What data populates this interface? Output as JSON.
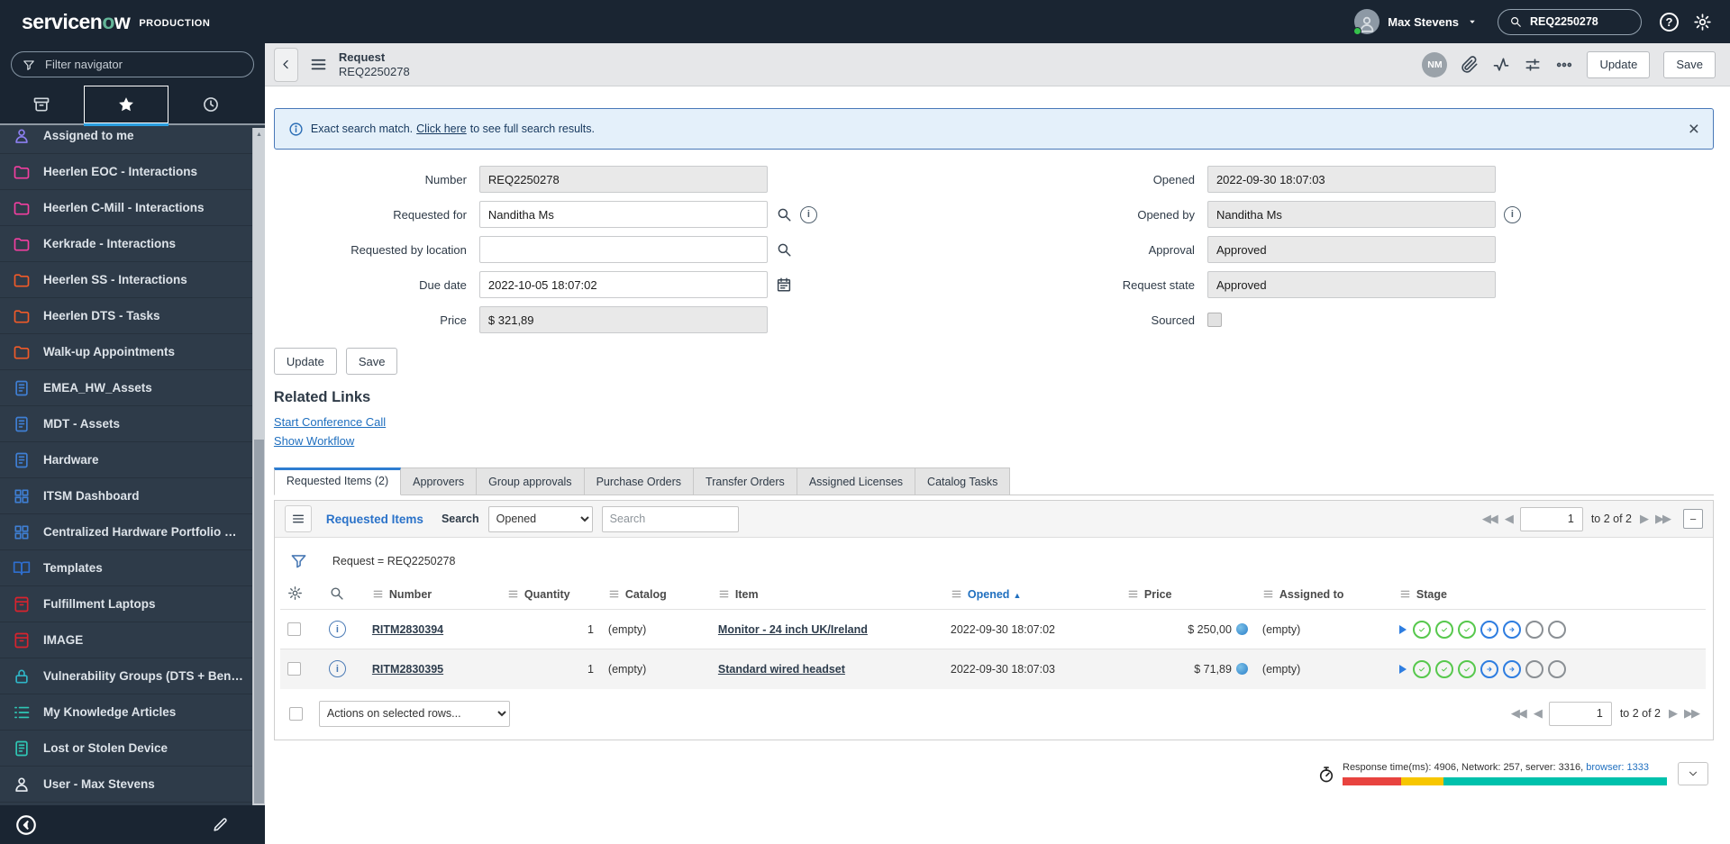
{
  "header": {
    "logo_prefix": "servicen",
    "logo_accent": "o",
    "logo_suffix": "w",
    "env_label": "PRODUCTION",
    "user_name": "Max Stevens",
    "search_value": "REQ2250278"
  },
  "sidebar": {
    "filter_placeholder": "Filter navigator",
    "items": [
      {
        "label": "Assigned to me",
        "icon": "person",
        "color": "#8c7ff0"
      },
      {
        "label": "Heerlen EOC - Interactions",
        "icon": "folder",
        "color": "#f23fa0"
      },
      {
        "label": "Heerlen C-Mill - Interactions",
        "icon": "folder",
        "color": "#f23fa0"
      },
      {
        "label": "Kerkrade - Interactions",
        "icon": "folder",
        "color": "#f23fa0"
      },
      {
        "label": "Heerlen SS - Interactions",
        "icon": "folder",
        "color": "#f05a28"
      },
      {
        "label": "Heerlen DTS - Tasks",
        "icon": "folder",
        "color": "#f05a28"
      },
      {
        "label": "Walk-up Appointments",
        "icon": "folder",
        "color": "#f05a28"
      },
      {
        "label": "EMEA_HW_Assets",
        "icon": "doc",
        "color": "#3f7fd4"
      },
      {
        "label": "MDT - Assets",
        "icon": "doc",
        "color": "#3f7fd4"
      },
      {
        "label": "Hardware",
        "icon": "doc",
        "color": "#3f7fd4"
      },
      {
        "label": "ITSM Dashboard",
        "icon": "grid",
        "color": "#3f7fd4"
      },
      {
        "label": "Centralized Hardware Portfolio …",
        "icon": "grid",
        "color": "#3f7fd4"
      },
      {
        "label": "Templates",
        "icon": "book",
        "color": "#2f6fd0"
      },
      {
        "label": "Fulfillment Laptops",
        "icon": "box",
        "color": "#d9232e"
      },
      {
        "label": "IMAGE",
        "icon": "box",
        "color": "#d9232e"
      },
      {
        "label": "Vulnerability Groups (DTS + Ben…",
        "icon": "lock",
        "color": "#2fb5c7"
      },
      {
        "label": "My Knowledge Articles",
        "icon": "list",
        "color": "#2fc7b5"
      },
      {
        "label": "Lost or Stolen Device",
        "icon": "doc",
        "color": "#2fc7b5"
      },
      {
        "label": "User - Max Stevens",
        "icon": "person",
        "color": "#e8edf2"
      }
    ]
  },
  "form_header": {
    "title": "Request",
    "subtitle": "REQ2250278",
    "avatar_initials": "NM",
    "update_label": "Update",
    "save_label": "Save"
  },
  "banner": {
    "prefix": "Exact search match.",
    "link": "Click here",
    "suffix": "to see full search results.",
    "close": "×"
  },
  "form": {
    "left": [
      {
        "label": "Number",
        "value": "REQ2250278",
        "readonly": true,
        "icons": []
      },
      {
        "label": "Requested for",
        "value": "Nanditha Ms",
        "readonly": false,
        "icons": [
          "magnifier",
          "info"
        ]
      },
      {
        "label": "Requested by location",
        "value": "",
        "readonly": false,
        "icons": [
          "magnifier"
        ]
      },
      {
        "label": "Due date",
        "value": "2022-10-05 18:07:02",
        "readonly": false,
        "icons": [
          "calendar"
        ]
      },
      {
        "label": "Price",
        "value": "$ 321,89",
        "readonly": true,
        "icons": []
      }
    ],
    "right": [
      {
        "label": "Opened",
        "value": "2022-09-30 18:07:03",
        "readonly": true,
        "icons": []
      },
      {
        "label": "Opened by",
        "value": "Nanditha Ms",
        "readonly": true,
        "icons": [
          "info"
        ]
      },
      {
        "label": "Approval",
        "value": "Approved",
        "readonly": true,
        "icons": []
      },
      {
        "label": "Request state",
        "value": "Approved",
        "readonly": true,
        "icons": []
      },
      {
        "label": "Sourced",
        "type": "checkbox",
        "checked": false
      }
    ],
    "buttons": {
      "update": "Update",
      "save": "Save"
    }
  },
  "related_links": {
    "title": "Related Links",
    "links": [
      "Start Conference Call",
      "Show Workflow"
    ]
  },
  "tabs": [
    {
      "label": "Requested Items (2)",
      "active": true
    },
    {
      "label": "Approvers",
      "active": false
    },
    {
      "label": "Group approvals",
      "active": false
    },
    {
      "label": "Purchase Orders",
      "active": false
    },
    {
      "label": "Transfer Orders",
      "active": false
    },
    {
      "label": "Assigned Licenses",
      "active": false
    },
    {
      "label": "Catalog Tasks",
      "active": false
    }
  ],
  "list": {
    "title": "Requested Items",
    "search_label": "Search",
    "search_column": "Opened",
    "search_placeholder": "Search",
    "filter_text": "Request = REQ2250278",
    "pagination": {
      "page": "1",
      "range_label": "to 2 of 2"
    },
    "columns": [
      {
        "label": "Number"
      },
      {
        "label": "Quantity",
        "align": "right"
      },
      {
        "label": "Catalog"
      },
      {
        "label": "Item"
      },
      {
        "label": "Opened",
        "sorted": "asc"
      },
      {
        "label": "Price",
        "align": "right"
      },
      {
        "label": "Assigned to"
      },
      {
        "label": "Stage"
      }
    ],
    "rows": [
      {
        "number": "RITM2830394",
        "quantity": "1",
        "catalog": "(empty)",
        "item": "Monitor - 24 inch UK/Ireland",
        "opened": "2022-09-30 18:07:02",
        "price": "$ 250,00",
        "assigned_to": "(empty)",
        "stage": {
          "start": true,
          "done": 3,
          "active": 2,
          "pending": 2
        }
      },
      {
        "number": "RITM2830395",
        "quantity": "1",
        "catalog": "(empty)",
        "item": "Standard wired headset",
        "opened": "2022-09-30 18:07:03",
        "price": "$ 71,89",
        "assigned_to": "(empty)",
        "stage": {
          "start": true,
          "done": 3,
          "active": 2,
          "pending": 2
        }
      }
    ],
    "actions_placeholder": "Actions on selected rows..."
  },
  "footer": {
    "response_text": "Response time(ms): 4906, Network: 257, server: 3316,",
    "browser_link": "browser: 1333",
    "segments": [
      {
        "name": "network",
        "color": "#e8433f",
        "pct": 18
      },
      {
        "name": "server",
        "color": "#f7c600",
        "pct": 13
      },
      {
        "name": "browser",
        "color": "#00c1ac",
        "pct": 69
      }
    ]
  }
}
